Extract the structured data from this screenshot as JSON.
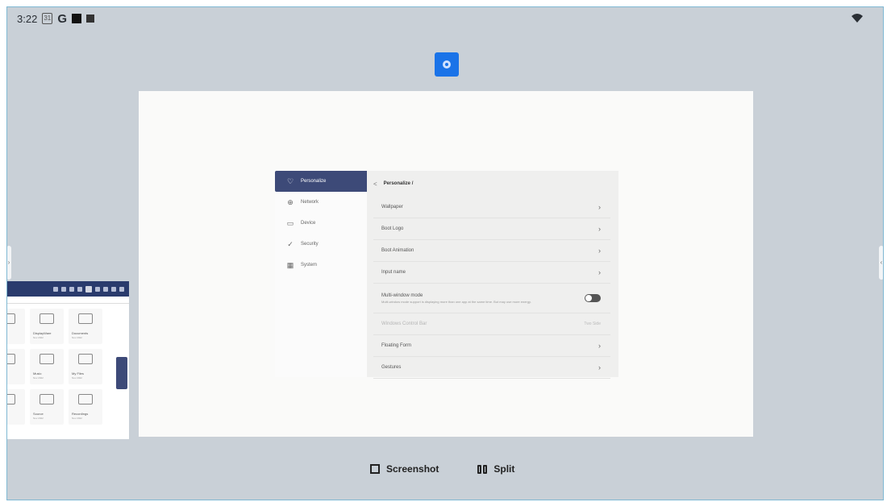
{
  "status_bar": {
    "time": "3:22",
    "cal_icon_text": "31",
    "g_label": "G"
  },
  "settings": {
    "nav": [
      {
        "label": "Personalize",
        "icon": "heart-icon",
        "glyph": "♡"
      },
      {
        "label": "Network",
        "icon": "globe-icon",
        "glyph": "⊕"
      },
      {
        "label": "Device",
        "icon": "monitor-icon",
        "glyph": "▭"
      },
      {
        "label": "Security",
        "icon": "shield-icon",
        "glyph": "✓"
      },
      {
        "label": "System",
        "icon": "grid-icon",
        "glyph": "▦"
      }
    ],
    "breadcrumb": "Personalize /",
    "back_glyph": "<",
    "rows": [
      {
        "label": "Wallpaper"
      },
      {
        "label": "Boot Logo"
      },
      {
        "label": "Boot Animation"
      },
      {
        "label": "Input name"
      }
    ],
    "multiwindow": {
      "label": "Multi-window mode",
      "desc": "Multi-window mode support is displaying more than one app at the same time. But may use more energy.",
      "enabled": true
    },
    "windows_control": {
      "label": "Windows Control Bar",
      "value": "Two Side"
    },
    "rows2": [
      {
        "label": "Floating Form"
      },
      {
        "label": "Gestures"
      }
    ]
  },
  "thumbnail": {
    "tiles": [
      {
        "name": "",
        "size": ""
      },
      {
        "name": "DisplayWare",
        "size": "Nov 2022"
      },
      {
        "name": "Documents",
        "size": "Nov 2022"
      },
      {
        "name": "",
        "size": ""
      },
      {
        "name": "Music",
        "size": "Nov 2022"
      },
      {
        "name": "My Files",
        "size": "Nov 2022"
      },
      {
        "name": "",
        "size": ""
      },
      {
        "name": "Source",
        "size": "Nov 2022"
      },
      {
        "name": "Recordings",
        "size": "Nov 2022"
      }
    ]
  },
  "bottom": {
    "screenshot_label": "Screenshot",
    "split_label": "Split"
  },
  "colors": {
    "accent": "#1a73e8",
    "nav_active": "#3d4a78",
    "backdrop": "#c9d0d7"
  }
}
